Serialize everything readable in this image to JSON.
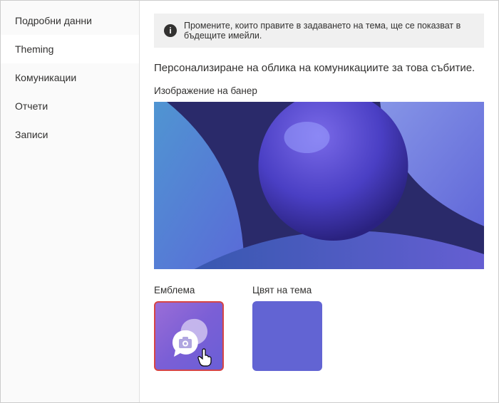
{
  "sidebar": {
    "items": [
      {
        "label": "Подробни данни"
      },
      {
        "label": "Theming"
      },
      {
        "label": "Комуникации"
      },
      {
        "label": "Отчети"
      },
      {
        "label": "Записи"
      }
    ],
    "activeIndex": 1
  },
  "infoBar": {
    "iconGlyph": "i",
    "text": "Промените, които правите в задаването на тема, ще се показват в бъдещите имейли."
  },
  "main": {
    "heading": "Персонализиране на облика на комуникациите за това събитие.",
    "bannerLabel": "Изображение на банер",
    "logoLabel": "Емблема",
    "themeColorLabel": "Цвят на тема"
  },
  "colors": {
    "themeColor": "#6264d3",
    "highlightBorder": "#d64545",
    "logoGradientStart": "#9a6dd7",
    "logoGradientEnd": "#6a5fd6"
  }
}
